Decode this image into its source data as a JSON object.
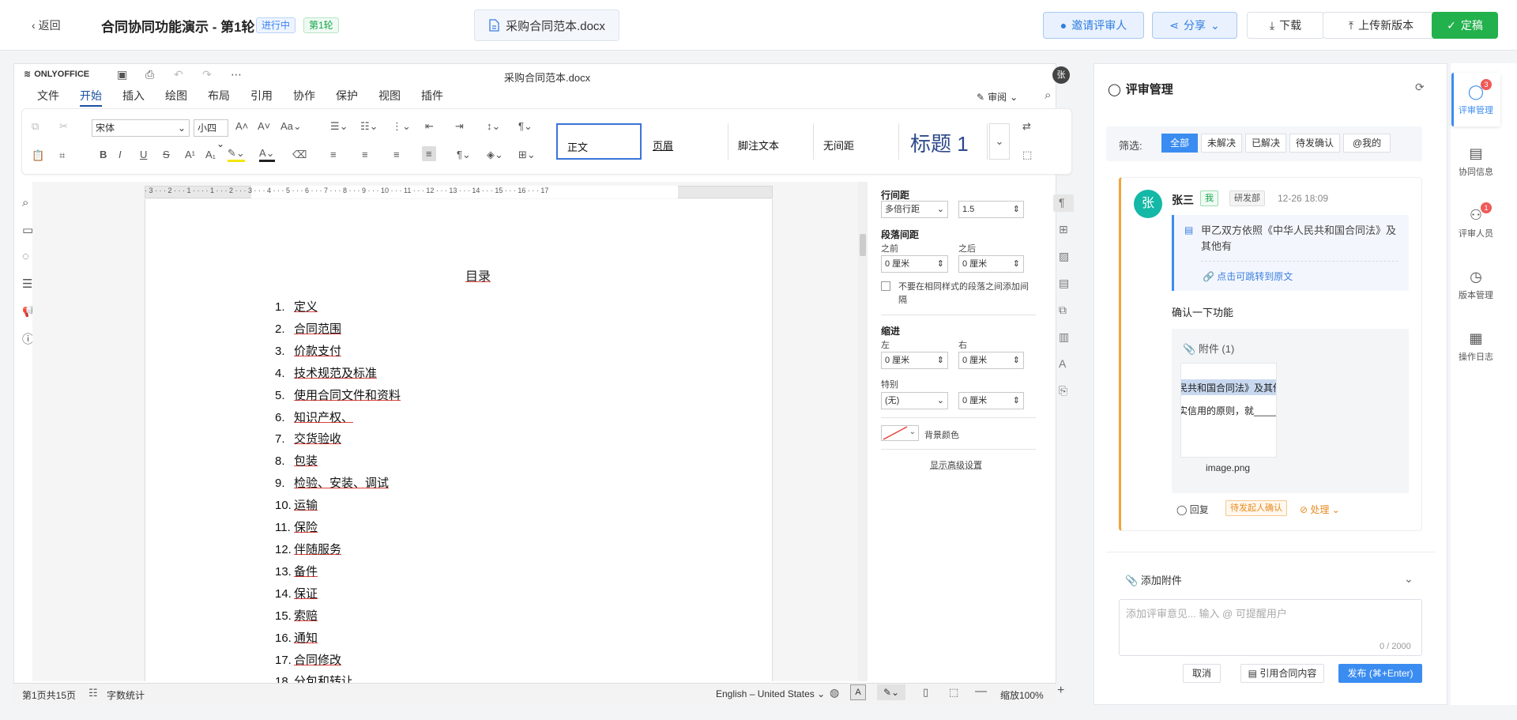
{
  "header": {
    "back_label": "返回",
    "title": "合同协同功能演示 - 第1轮",
    "status_badge": "进行中",
    "round_badge": "第1轮",
    "file_name": "采购合同范本.docx",
    "invite_label": "邀请评审人",
    "share_label": "分享",
    "download_label": "下载",
    "upload_label": "上传新版本",
    "finalize_label": "定稿"
  },
  "editor": {
    "app_name": "ONLYOFFICE",
    "doc_name": "采购合同范本.docx",
    "user_initial": "张",
    "menu": [
      "文件",
      "开始",
      "插入",
      "绘图",
      "布局",
      "引用",
      "协作",
      "保护",
      "视图",
      "插件"
    ],
    "active_menu": "开始",
    "review_label": "审阅",
    "font_name": "宋体",
    "font_size": "小四",
    "styles": [
      "正文",
      "页眉",
      "脚注文本",
      "无间距",
      "标题 1"
    ],
    "toc_title": "目录",
    "toc_items": [
      {
        "n": "1.",
        "t": "定义"
      },
      {
        "n": "2.",
        "t": "合同范围"
      },
      {
        "n": "3.",
        "t": "价款支付"
      },
      {
        "n": "4.",
        "t": "技术规范及标准"
      },
      {
        "n": "5.",
        "t": "使用合同文件和资料"
      },
      {
        "n": "6.",
        "t": "知识产权、"
      },
      {
        "n": "7.",
        "t": "交货验收"
      },
      {
        "n": "8.",
        "t": "包装"
      },
      {
        "n": "9.",
        "t": "检验、安装、调试"
      },
      {
        "n": "10.",
        "t": "运输"
      },
      {
        "n": "11.",
        "t": "保险"
      },
      {
        "n": "12.",
        "t": "伴随服务"
      },
      {
        "n": "13.",
        "t": "备件"
      },
      {
        "n": "14.",
        "t": "保证"
      },
      {
        "n": "15.",
        "t": "索赔"
      },
      {
        "n": "16.",
        "t": "通知"
      },
      {
        "n": "17.",
        "t": "合同修改"
      },
      {
        "n": "18.",
        "t": "分包和转让"
      }
    ],
    "ruler_marks": "· 3 · · · 2 · · · 1 · · · · 1 · · · 2 · · · 3 · · · 4 · · · 5 · · · 6 · · · 7 · · · 8 · · · 9 · · · 10 · · · 11 · · · 12 · · · 13 · · · 14 · · · 15 · · · 16 · · · 17"
  },
  "paragraph": {
    "line_spacing_label": "行间距",
    "line_spacing_mode": "多倍行距",
    "line_spacing_value": "1.5",
    "para_spacing_label": "段落间距",
    "before_label": "之前",
    "after_label": "之后",
    "before_value": "0 厘米",
    "after_value": "0 厘米",
    "checkbox_label": "不要在相同样式的段落之间添加间隔",
    "indent_label": "缩进",
    "left_label": "左",
    "right_label": "右",
    "left_value": "0 厘米",
    "right_value": "0 厘米",
    "special_label": "特别",
    "special_value": "(无)",
    "special_amount": "0 厘米",
    "bg_color_label": "背景颜色",
    "advanced_label": "显示高级设置"
  },
  "statusbar": {
    "page_info": "第1页共15页",
    "word_count": "字数统计",
    "language": "English – United States",
    "zoom": "缩放100%"
  },
  "review": {
    "title": "评审管理",
    "filter_label": "筛选:",
    "filters": [
      "全部",
      "未解决",
      "已解决",
      "待发确认",
      "@我的"
    ],
    "comment": {
      "avatar": "张",
      "name": "张三",
      "me_tag": "我",
      "dept": "研发部",
      "time": "12-26 18:09",
      "quote": "甲乙双方依照《中华人民共和国合同法》及其他有",
      "jump_link": "点击可跳转到原文",
      "body": "确认一下功能",
      "attachment_label": "附件 (1)",
      "thumb_line1": "民共和国合同法》及其他",
      "thumb_line2": "实信用的原则，就______",
      "attachment_name": "image.png",
      "reply_label": "回复",
      "pending_tag": "待发起人确认",
      "process_label": "处理"
    },
    "add_attachment": "添加附件",
    "input_placeholder": "添加评审意见... 输入 @ 可提醒用户",
    "char_count": "0 / 2000",
    "cancel_label": "取消",
    "quote_contract_label": "引用合同内容",
    "publish_label": "发布 (⌘+Enter)"
  },
  "sidebar": {
    "items": [
      {
        "label": "评审管理",
        "badge": "3"
      },
      {
        "label": "协同信息",
        "badge": ""
      },
      {
        "label": "评审人员",
        "badge": "1"
      },
      {
        "label": "版本管理",
        "badge": ""
      },
      {
        "label": "操作日志",
        "badge": ""
      }
    ]
  },
  "colors": {
    "primary": "#3b8cf0",
    "success": "#22b14c",
    "warning": "#f2a33a",
    "avatar": "#14b8a6"
  }
}
